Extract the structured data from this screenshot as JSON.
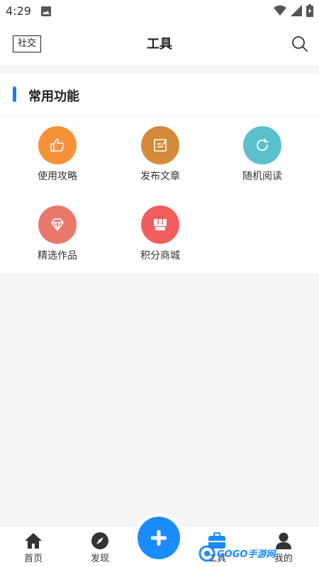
{
  "status_bar": {
    "time": "4:29"
  },
  "header": {
    "social_label": "社交",
    "title": "工具"
  },
  "section": {
    "title": "常用功能"
  },
  "functions": [
    {
      "label": "使用攻略",
      "icon": "thumbs-up-icon",
      "color": "#f7923b"
    },
    {
      "label": "发布文章",
      "icon": "edit-icon",
      "color": "#d38b3b"
    },
    {
      "label": "随机阅读",
      "icon": "refresh-icon",
      "color": "#5bbfcc"
    },
    {
      "label": "精选作品",
      "icon": "diamond-icon",
      "color": "#e9776b"
    },
    {
      "label": "积分商城",
      "icon": "store-icon",
      "color": "#f25d5d"
    }
  ],
  "bottom_nav": {
    "home": "首页",
    "discover": "发现",
    "tools": "工具",
    "mine": "我的"
  },
  "watermark": {
    "text": "GOGO手游网"
  },
  "colors": {
    "accent": "#1a8cff",
    "section_bar": "#1a7cf0"
  }
}
